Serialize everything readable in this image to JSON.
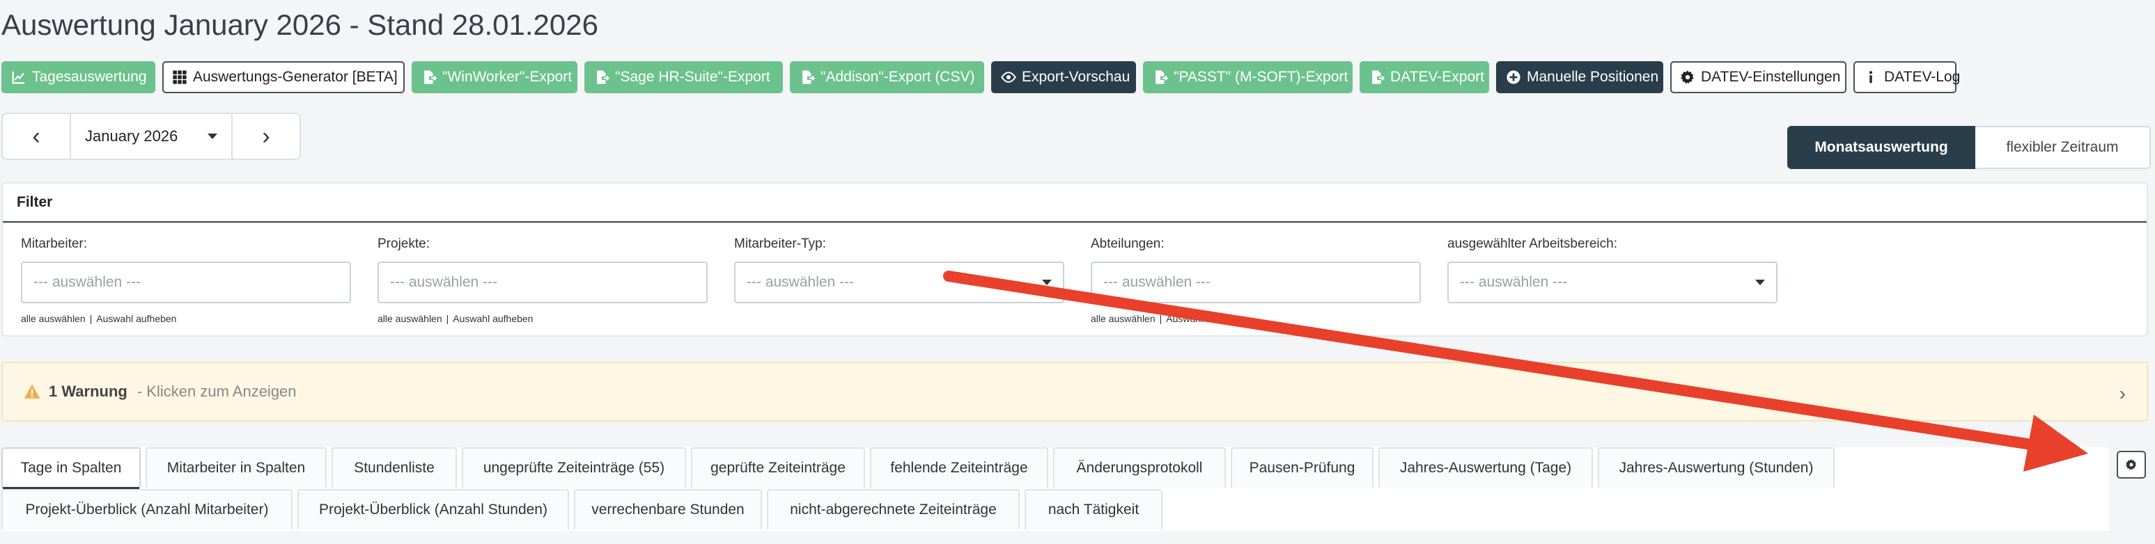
{
  "page": {
    "title": "Auswertung January 2026 - Stand 28.01.2026"
  },
  "toolbar": {
    "buttons": [
      {
        "label": "Tagesauswertung",
        "icon": "chart-line-icon",
        "style": "green"
      },
      {
        "label": "Auswertungs-Generator [BETA]",
        "icon": "grid-icon",
        "style": "outline"
      },
      {
        "label": "\"WinWorker\"-Export",
        "icon": "file-export-icon",
        "style": "green"
      },
      {
        "label": "\"Sage HR-Suite\"-Export",
        "icon": "file-export-icon",
        "style": "green"
      },
      {
        "label": "\"Addison\"-Export (CSV)",
        "icon": "file-export-icon",
        "style": "green"
      },
      {
        "label": "Export-Vorschau",
        "icon": "eye-icon",
        "style": "dark"
      },
      {
        "label": "\"PASST\" (M-SOFT)-Export",
        "icon": "file-export-icon",
        "style": "green"
      },
      {
        "label": "DATEV-Export",
        "icon": "file-export-icon",
        "style": "green"
      },
      {
        "label": "Manuelle Positionen",
        "icon": "plus-circle-icon",
        "style": "dark"
      },
      {
        "label": "DATEV-Einstellungen",
        "icon": "gear-icon",
        "style": "outline"
      },
      {
        "label": "DATEV-Log",
        "icon": "info-icon",
        "style": "outline"
      }
    ]
  },
  "month_nav": {
    "prev": "‹",
    "next": "›",
    "selected": "January 2026"
  },
  "mode_toggle": {
    "active": "Monatsauswertung",
    "inactive": "flexibler Zeitraum"
  },
  "filter": {
    "title": "Filter",
    "fields": [
      {
        "label": "Mitarbeiter:",
        "placeholder": "--- auswählen ---",
        "dropdown": false,
        "select_all": "alle auswählen",
        "clear": "Auswahl aufheben"
      },
      {
        "label": "Projekte:",
        "placeholder": "--- auswählen ---",
        "dropdown": false,
        "select_all": "alle auswählen",
        "clear": "Auswahl aufheben"
      },
      {
        "label": "Mitarbeiter-Typ:",
        "placeholder": "--- auswählen ---",
        "dropdown": true,
        "select_all": "",
        "clear": ""
      },
      {
        "label": "Abteilungen:",
        "placeholder": "--- auswählen ---",
        "dropdown": false,
        "select_all": "alle auswählen",
        "clear": "Auswahl aufheben"
      },
      {
        "label": "ausgewählter Arbeitsbereich:",
        "placeholder": "--- auswählen ---",
        "dropdown": true,
        "select_all": "",
        "clear": ""
      }
    ]
  },
  "warning": {
    "title": "1 Warnung",
    "hint": "- Klicken zum Anzeigen",
    "color": "#f0ad4e"
  },
  "tabs": [
    {
      "label": "Tage in Spalten",
      "active": true
    },
    {
      "label": "Mitarbeiter in Spalten"
    },
    {
      "label": "Stundenliste"
    },
    {
      "label": "ungeprüfte Zeiteinträge (55)"
    },
    {
      "label": "geprüfte Zeiteinträge"
    },
    {
      "label": "fehlende Zeiteinträge"
    },
    {
      "label": "Änderungsprotokoll"
    },
    {
      "label": "Pausen-Prüfung"
    },
    {
      "label": "Jahres-Auswertung (Tage)"
    },
    {
      "label": "Jahres-Auswertung (Stunden)"
    },
    {
      "label": "Projekt-Überblick (Anzahl Mitarbeiter)"
    },
    {
      "label": "Projekt-Überblick (Anzahl Stunden)"
    },
    {
      "label": "verrechenbare Stunden"
    },
    {
      "label": "nicht-abgerechnete Zeiteinträge"
    },
    {
      "label": "nach Tätigkeit"
    }
  ],
  "colors": {
    "green": "#6cc28c",
    "dark": "#2a3d4b",
    "annotation_arrow": "#e8402a",
    "warning_bg": "#fdf7e4"
  }
}
